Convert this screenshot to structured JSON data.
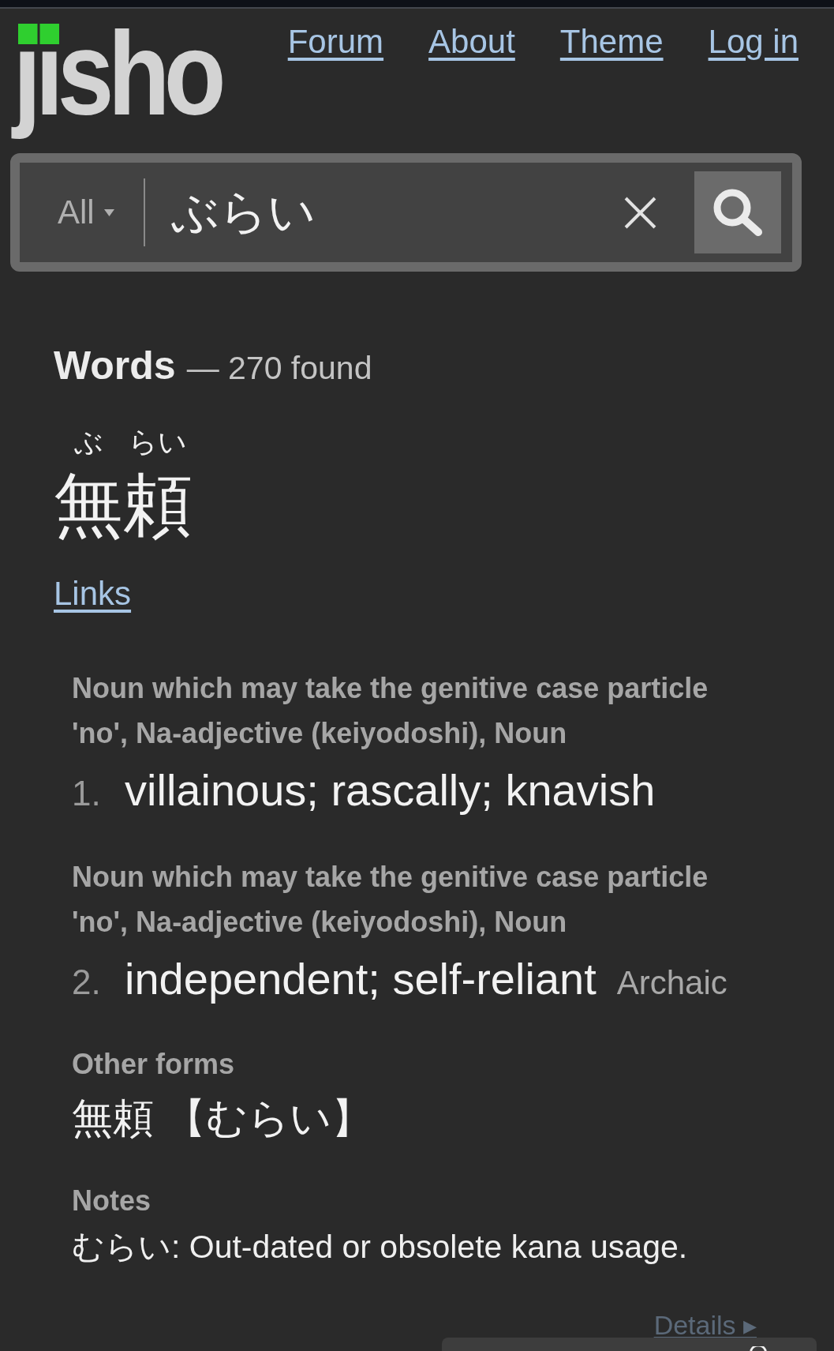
{
  "header": {
    "logo": "jisho",
    "nav_links": [
      "Forum",
      "About",
      "Theme",
      "Log in"
    ]
  },
  "search": {
    "filter": "All",
    "query": "ぶらい"
  },
  "results": {
    "heading": "Words",
    "count": "— 270 found"
  },
  "entry": {
    "furigana": [
      "ぶ",
      "らい"
    ],
    "word": "無頼",
    "links": "Links",
    "senses": [
      {
        "tags": "Noun which may take the genitive case particle 'no', Na-adjective (keiyodoshi), Noun",
        "number": "1.",
        "meaning": "villainous; rascally; knavish"
      },
      {
        "tags": "Noun which may take the genitive case particle 'no', Na-adjective (keiyodoshi), Noun",
        "number": "2.",
        "meaning": "independent; self-reliant",
        "note": "Archaic"
      }
    ],
    "other_forms": {
      "label": "Other forms",
      "forms": [
        "無頼 【むらい】"
      ]
    },
    "notes": {
      "label": "Notes",
      "text": "むらい: Out-dated or obsolete kana usage."
    },
    "details_link": "Details ▸"
  }
}
